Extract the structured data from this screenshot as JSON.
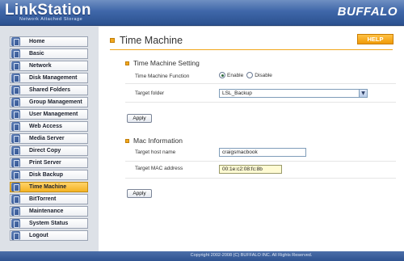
{
  "header": {
    "product": "LinkStation",
    "tagline": "Network Attached Storage",
    "brand": "BUFFALO"
  },
  "sidebar": {
    "items": [
      {
        "label": "Home",
        "icon": "home-icon",
        "active": false
      },
      {
        "label": "Basic",
        "icon": "basic-icon",
        "active": false
      },
      {
        "label": "Network",
        "icon": "network-icon",
        "active": false
      },
      {
        "label": "Disk Management",
        "icon": "disk-management-icon",
        "active": false
      },
      {
        "label": "Shared Folders",
        "icon": "shared-folders-icon",
        "active": false
      },
      {
        "label": "Group Management",
        "icon": "group-management-icon",
        "active": false
      },
      {
        "label": "User Management",
        "icon": "user-management-icon",
        "active": false
      },
      {
        "label": "Web Access",
        "icon": "web-access-icon",
        "active": false
      },
      {
        "label": "Media Server",
        "icon": "media-server-icon",
        "active": false
      },
      {
        "label": "Direct Copy",
        "icon": "direct-copy-icon",
        "active": false
      },
      {
        "label": "Print Server",
        "icon": "print-server-icon",
        "active": false
      },
      {
        "label": "Disk Backup",
        "icon": "disk-backup-icon",
        "active": false
      },
      {
        "label": "Time Machine",
        "icon": "time-machine-icon",
        "active": true
      },
      {
        "label": "BitTorrent",
        "icon": "bittorrent-icon",
        "active": false
      },
      {
        "label": "Maintenance",
        "icon": "maintenance-icon",
        "active": false
      },
      {
        "label": "System Status",
        "icon": "system-status-icon",
        "active": false
      },
      {
        "label": "Logout",
        "icon": "logout-icon",
        "active": false
      }
    ]
  },
  "main": {
    "title": "Time Machine",
    "help_label": "HELP",
    "settings": {
      "heading": "Time Machine Setting",
      "function_label": "Time Machine Function",
      "enable_label": "Enable",
      "disable_label": "Disable",
      "selected": "Enable",
      "folder_label": "Target folder",
      "folder_value": "LSL_Backup",
      "apply_label": "Apply"
    },
    "mac": {
      "heading": "Mac Information",
      "host_label": "Target host name",
      "host_value": "craigsmacbook",
      "mac_label": "Target MAC address",
      "mac_value": "00:1e:c2:08:fc:8b",
      "apply_label": "Apply"
    }
  },
  "footer": {
    "copyright": "Copyright 2002-2008 (C) BUFFALO INC. All Rights Reserved."
  },
  "colors": {
    "header": "#3f67a9",
    "accent": "#f2a81d",
    "active_nav": "#f5b323"
  }
}
